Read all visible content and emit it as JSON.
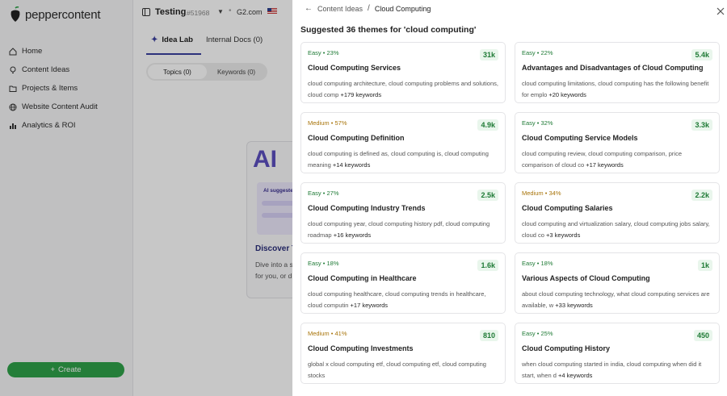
{
  "brand": {
    "name": "peppercontent",
    "color": "#2fa24a"
  },
  "sidebar": {
    "items": [
      {
        "label": "Home",
        "icon": "home-icon"
      },
      {
        "label": "Content Ideas",
        "icon": "lightbulb-icon"
      },
      {
        "label": "Projects & Items",
        "icon": "folder-icon"
      },
      {
        "label": "Website Content Audit",
        "icon": "globe-icon"
      },
      {
        "label": "Analytics & ROI",
        "icon": "bar-chart-icon"
      }
    ],
    "create_label": "Create"
  },
  "main": {
    "project_name": "Testing",
    "project_id": "#51968",
    "domain": "G2.com",
    "tabs": [
      {
        "label": "Idea Lab"
      },
      {
        "label": "Internal Docs (0)"
      }
    ],
    "segments": [
      {
        "label": "Topics (0)"
      },
      {
        "label": "Keywords (0)"
      }
    ],
    "promo": {
      "ai_text": "AI",
      "badge": "AI suggeste",
      "title": "Discover T",
      "desc_line1": "Dive into a s",
      "desc_line2": "for you, or d"
    }
  },
  "drawer": {
    "breadcrumb_parent": "Content Ideas",
    "breadcrumb_current": "Cloud Computing",
    "title": "Suggested 36 themes for 'cloud computing'",
    "cards": [
      {
        "difficulty": "Easy",
        "pct": "23%",
        "volume": "31k",
        "title": "Cloud Computing Services",
        "desc": "cloud computing architecture, cloud computing problems and solutions, cloud comp",
        "more": "+179 keywords"
      },
      {
        "difficulty": "Easy",
        "pct": "22%",
        "volume": "5.4k",
        "title": "Advantages and Disadvantages of Cloud Computing",
        "desc": "cloud computing limitations, cloud computing has the following benefit for emplo",
        "more": "+20 keywords"
      },
      {
        "difficulty": "Medium",
        "pct": "57%",
        "volume": "4.9k",
        "title": "Cloud Computing Definition",
        "desc": "cloud computing is defined as, cloud computing is, cloud computing meaning",
        "more": "+14 keywords"
      },
      {
        "difficulty": "Easy",
        "pct": "32%",
        "volume": "3.3k",
        "title": "Cloud Computing Service Models",
        "desc": "cloud computing review, cloud computing comparison, price comparison of cloud co",
        "more": "+17 keywords"
      },
      {
        "difficulty": "Easy",
        "pct": "27%",
        "volume": "2.5k",
        "title": "Cloud Computing Industry Trends",
        "desc": "cloud computing year, cloud computing history pdf, cloud computing roadmap",
        "more": "+16 keywords"
      },
      {
        "difficulty": "Medium",
        "pct": "34%",
        "volume": "2.2k",
        "title": "Cloud Computing Salaries",
        "desc": "cloud computing and virtualization salary, cloud computing jobs salary, cloud co",
        "more": "+3 keywords"
      },
      {
        "difficulty": "Easy",
        "pct": "18%",
        "volume": "1.6k",
        "title": "Cloud Computing in Healthcare",
        "desc": "cloud computing healthcare, cloud computing trends in healthcare, cloud computin",
        "more": "+17 keywords"
      },
      {
        "difficulty": "Easy",
        "pct": "18%",
        "volume": "1k",
        "title": "Various Aspects of Cloud Computing",
        "desc": "about cloud computing technology, what cloud computing services are available, w",
        "more": "+33 keywords"
      },
      {
        "difficulty": "Medium",
        "pct": "41%",
        "volume": "810",
        "title": "Cloud Computing Investments",
        "desc": "global x cloud computing etf, cloud computing etf, cloud computing stocks",
        "more": ""
      },
      {
        "difficulty": "Easy",
        "pct": "25%",
        "volume": "450",
        "title": "Cloud Computing History",
        "desc": "when cloud computing started in india, cloud computing when did it start, when d",
        "more": "+4 keywords"
      }
    ]
  }
}
